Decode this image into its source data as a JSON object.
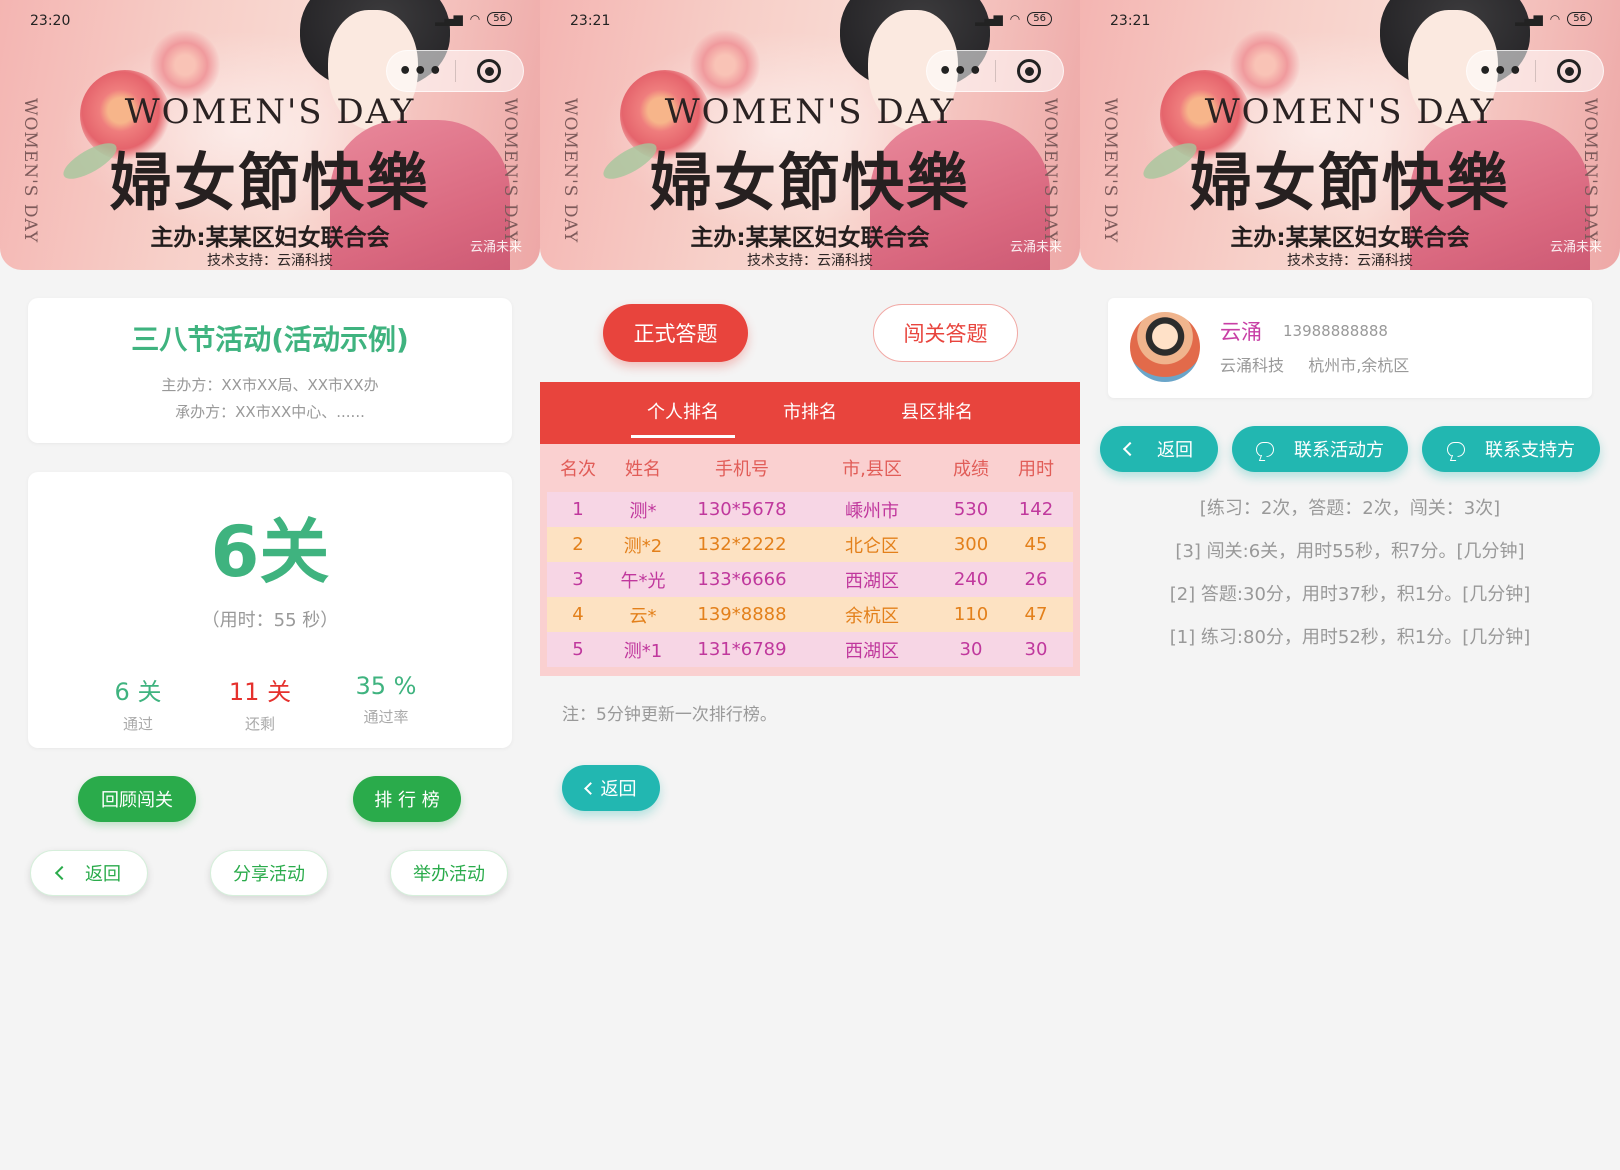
{
  "banner": {
    "side_text": "WOMEN'S DAY",
    "title_en": "WOMEN'S DAY",
    "title_cn": "婦女節快樂",
    "organizer": "主办:某某区妇女联合会",
    "support": "技术支持：云涌科技",
    "watermark": "云涌未来",
    "capsule_more": "•••"
  },
  "status": [
    {
      "time": "23:20",
      "battery": "56"
    },
    {
      "time": "23:21",
      "battery": "56"
    },
    {
      "time": "23:21",
      "battery": "56"
    }
  ],
  "screen1": {
    "activity_title": "三八节活动(活动示例)",
    "host": "主办方：XX市XX局、XX市XX办",
    "undertaker": "承办方：XX市XX中心、......",
    "score": "6关",
    "time_used": "（用时：55 秒）",
    "stats": [
      {
        "value": "6 关",
        "label": "通过",
        "color": "#3fb37f"
      },
      {
        "value": "11 关",
        "label": "还剩",
        "color": "#e5312d"
      },
      {
        "value": "35 %",
        "label": "通过率",
        "color": "#3fb37f"
      }
    ],
    "review_button": "回顾闯关",
    "ranking_button": "排 行 榜",
    "back_button": "返回",
    "share_button": "分享活动",
    "host_button": "举办活动"
  },
  "screen2": {
    "tab_formal": "正式答题",
    "tab_challenge": "闯关答题",
    "rank_tabs": [
      "个人排名",
      "市排名",
      "县区排名"
    ],
    "table": {
      "headers": [
        "名次",
        "姓名",
        "手机号",
        "市,县区",
        "成绩",
        "用时"
      ],
      "rows": [
        [
          "1",
          "测*",
          "130*5678",
          "嵊州市",
          "530",
          "142"
        ],
        [
          "2",
          "测*2",
          "132*2222",
          "北仑区",
          "300",
          "45"
        ],
        [
          "3",
          "午*光",
          "133*6666",
          "西湖区",
          "240",
          "26"
        ],
        [
          "4",
          "云*",
          "139*8888",
          "余杭区",
          "110",
          "47"
        ],
        [
          "5",
          "测*1",
          "131*6789",
          "西湖区",
          "30",
          "30"
        ]
      ]
    },
    "note": "注：5分钟更新一次排行榜。",
    "back_button": "返回"
  },
  "screen3": {
    "user_name": "云涌",
    "user_phone": "13988888888",
    "user_company": "云涌科技",
    "user_location": "杭州市,余杭区",
    "back_button": "返回",
    "contact_organizer": "联系活动方",
    "contact_support": "联系支持方",
    "summary": "[练习：2次，答题：2次，闯关：3次]",
    "records": [
      "[3] 闯关:6关，用时55秒，积7分。[几分钟]",
      "[2] 答题:30分，用时37秒，积1分。[几分钟]",
      "[1] 练习:80分，用时52秒，积1分。[几分钟]"
    ]
  },
  "colors": {
    "green": "#3fb37f",
    "button_green": "#2aab4b",
    "red": "#e8443d",
    "teal": "#22b7b1",
    "magenta": "#c0389d",
    "orange": "#e3801b"
  }
}
